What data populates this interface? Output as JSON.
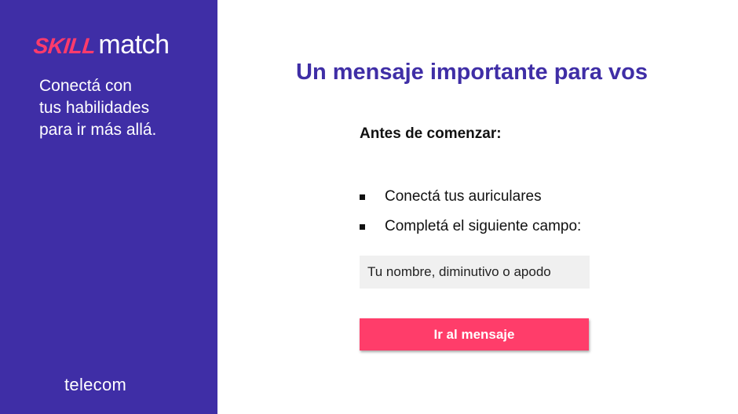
{
  "brand": {
    "logo_skill": "SKILL",
    "logo_match": "match",
    "tagline_lines": [
      "Conectá con",
      "tus habilidades",
      "para ir más allá."
    ],
    "company": "telecom",
    "colors": {
      "sidebar": "#3f2ea6",
      "accent": "#ff3d6a",
      "title": "#3f2ea6",
      "input_bg": "#f0f0f0"
    }
  },
  "main": {
    "title": "Un mensaje importante para vos",
    "subtitle": "Antes de comenzar:",
    "steps": [
      {
        "text": "Conectá tus auriculares",
        "icon": "square-bullet"
      },
      {
        "text": "Completá el siguiente campo:",
        "icon": "square-bullet"
      }
    ],
    "name_input": {
      "placeholder": "Tu nombre, diminutivo o apodo",
      "value": ""
    },
    "cta_label": "Ir al mensaje"
  }
}
